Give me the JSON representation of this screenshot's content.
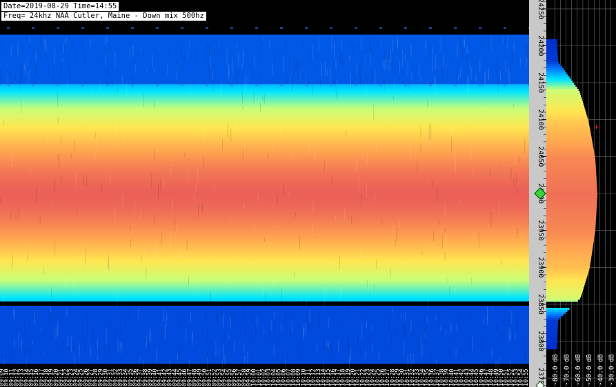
{
  "header": {
    "date_line": "Date=2019-08-29 Time=14:55",
    "freq_line": "Freq= 24khz NAA Cutler, Maine - Down mix 500hz"
  },
  "frequency_axis": {
    "unit": "Hz",
    "labels": [
      "24250",
      "24200",
      "24150",
      "24100",
      "24050",
      "24000",
      "23950",
      "23900",
      "23850",
      "23800",
      "23750"
    ],
    "range": [
      23738,
      24262
    ]
  },
  "time_axis": {
    "labels": [
      "09:09",
      "09:10",
      "09:11",
      "09:12",
      "09:13",
      "09:14",
      "09:15",
      "09:16",
      "09:17",
      "09:18",
      "09:19",
      "09:20",
      "09:21",
      "09:22",
      "09:23",
      "09:24",
      "09:25",
      "09:26",
      "09:27",
      "09:28",
      "09:29",
      "09:30",
      "09:31",
      "09:32",
      "09:33",
      "09:34",
      "09:35",
      "09:36",
      "09:37",
      "09:38",
      "09:39",
      "09:40",
      "09:41",
      "09:42",
      "09:43",
      "09:44",
      "09:45",
      "09:46",
      "09:47",
      "09:48",
      "09:49",
      "09:50",
      "09:51",
      "09:52",
      "09:53",
      "09:54",
      "09:55",
      "09:56",
      "09:57",
      "09:58",
      "09:59",
      "10:00",
      "10:01",
      "10:02",
      "10:03",
      "10:04",
      "10:05",
      "10:06",
      "10:07",
      "10:08",
      "10:09",
      "10:10",
      "10:11",
      "10:12",
      "10:13",
      "10:14",
      "10:15",
      "10:16",
      "10:17",
      "10:18",
      "10:19",
      "10:20",
      "10:21",
      "10:22",
      "10:23",
      "10:24",
      "10:25",
      "10:26",
      "10:27",
      "10:28",
      "10:29",
      "10:30",
      "10:31",
      "10:32",
      "10:33",
      "10:34",
      "10:35",
      "10:36",
      "10:37",
      "10:38",
      "10:39",
      "10:40",
      "10:41",
      "10:42",
      "10:43",
      "10:44",
      "10:45",
      "10:46",
      "10:47",
      "10:48",
      "10:49",
      "10:50",
      "10:51",
      "10:52",
      "10:53",
      "10:54",
      "10:55"
    ]
  },
  "spectrum_axis": {
    "labels": [
      "-80.0 dB",
      "-70.0 dB",
      "-60.0 dB",
      "-50.0 dB",
      "-40.0 dB",
      "-30.0 dB"
    ],
    "range_db": [
      -85,
      -28
    ]
  },
  "marker": {
    "freq_hz": 24000,
    "color": "#3cd23c"
  },
  "colors": {
    "background": "#000000",
    "axis_bg": "#c8c8c8",
    "colormap": [
      "#000064",
      "#0028c8",
      "#0080ff",
      "#00e6ff",
      "#c8ff78",
      "#ffe650",
      "#ffa050",
      "#e6505a"
    ]
  },
  "chart_data": {
    "type": "heatmap",
    "title": "",
    "xlabel": "",
    "ylabel": "",
    "bands": [
      {
        "from_hz": 24150,
        "to_hz": 24215,
        "level": 0.22
      },
      {
        "from_hz": 23855,
        "to_hz": 24148,
        "level": 0.95
      },
      {
        "from_hz": 23770,
        "to_hz": 23848,
        "level": 0.2
      }
    ],
    "spectrum_db": [
      {
        "freq_hz": 24210,
        "db": -78
      },
      {
        "freq_hz": 24180,
        "db": -77
      },
      {
        "freq_hz": 24140,
        "db": -58
      },
      {
        "freq_hz": 24100,
        "db": -50
      },
      {
        "freq_hz": 24050,
        "db": -44
      },
      {
        "freq_hz": 24000,
        "db": -42
      },
      {
        "freq_hz": 23950,
        "db": -44
      },
      {
        "freq_hz": 23900,
        "db": -49
      },
      {
        "freq_hz": 23860,
        "db": -57
      },
      {
        "freq_hz": 23830,
        "db": -77
      },
      {
        "freq_hz": 23790,
        "db": -78
      }
    ]
  }
}
